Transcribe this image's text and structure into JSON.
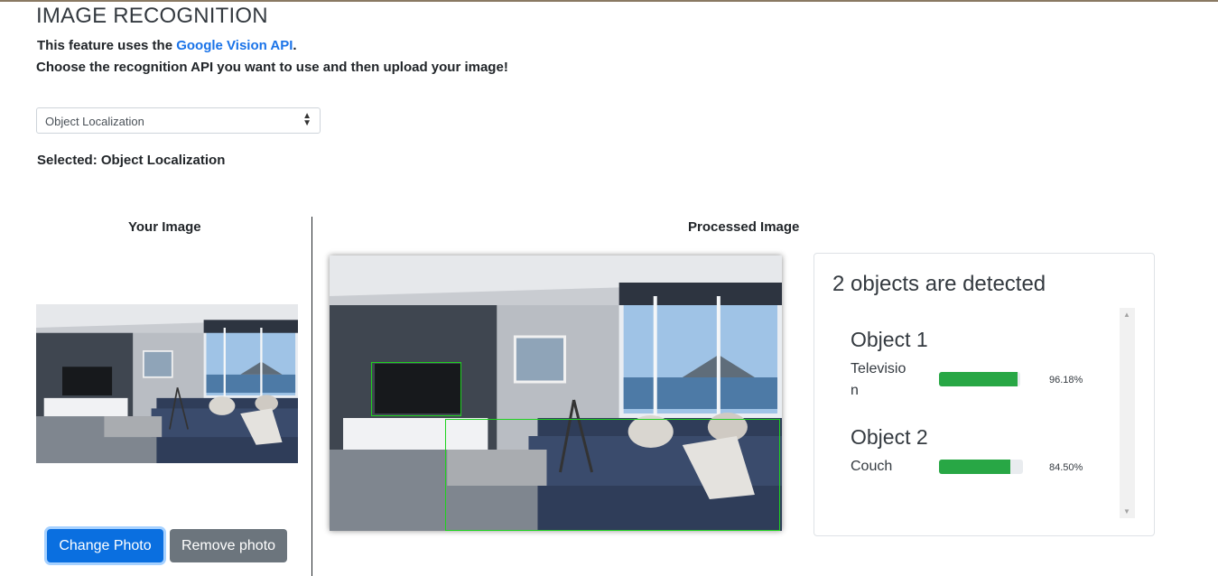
{
  "page": {
    "title": "IMAGE RECOGNITION",
    "intro_prefix": "This feature uses the ",
    "intro_link": "Google Vision API",
    "intro_suffix": ".",
    "intro_line2": "Choose the recognition API you want to use and then upload your image!"
  },
  "api_select": {
    "value": "Object Localization"
  },
  "selected_text": "Selected: Object Localization",
  "columns": {
    "your_image": "Your Image",
    "processed_image": "Processed Image"
  },
  "buttons": {
    "change_photo": "Change Photo",
    "remove_photo": "Remove photo"
  },
  "results": {
    "title": "2 objects are detected",
    "objects": [
      {
        "heading": "Object 1",
        "label": "Television",
        "confidence": 0.9618,
        "percent_text": "96.18%"
      },
      {
        "heading": "Object 2",
        "label": "Couch",
        "confidence": 0.845,
        "percent_text": "84.50%"
      }
    ]
  },
  "colors": {
    "link": "#1a73e8",
    "primary_button": "#0a6fe0",
    "secondary_button": "#6c757d",
    "progress": "#28a745",
    "bounding_box": "#1fd21f"
  }
}
